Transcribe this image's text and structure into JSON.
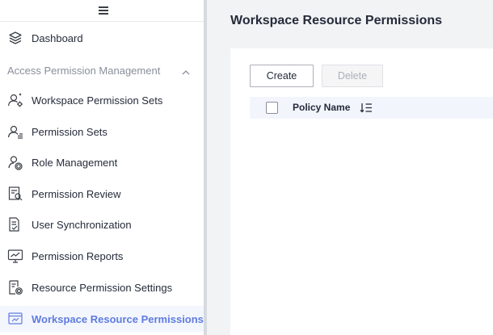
{
  "sidebar": {
    "toggle_icon": "hamburger-icon",
    "dashboard": {
      "label": "Dashboard",
      "icon": "layers-icon"
    },
    "group": {
      "label": "Access Permission Management",
      "expanded": true,
      "icon": "chevron-up-icon"
    },
    "items": [
      {
        "label": "Workspace Permission Sets",
        "icon": "user-gear-icon",
        "active": false
      },
      {
        "label": "Permission Sets",
        "icon": "user-list-icon",
        "active": false
      },
      {
        "label": "Role Management",
        "icon": "user-cog-icon",
        "active": false
      },
      {
        "label": "Permission Review",
        "icon": "review-document-icon",
        "active": false
      },
      {
        "label": "User Synchronization",
        "icon": "sync-document-icon",
        "active": false
      },
      {
        "label": "Permission Reports",
        "icon": "report-monitor-icon",
        "active": false
      },
      {
        "label": "Resource Permission Settings",
        "icon": "settings-document-icon",
        "active": false
      },
      {
        "label": "Workspace Resource Permissions",
        "icon": "workspace-resource-icon",
        "active": true
      }
    ]
  },
  "main": {
    "title": "Workspace Resource Permissions",
    "toolbar": {
      "create_label": "Create",
      "delete_label": "Delete"
    },
    "table": {
      "columns": [
        {
          "label": "Policy Name",
          "sortable": true
        }
      ],
      "rows": []
    }
  },
  "colors": {
    "accent": "#5e7ce0",
    "text": "#252b3a",
    "muted": "#8a8e99",
    "background": "#f2f3f5",
    "table_header": "#f2f5fc"
  }
}
